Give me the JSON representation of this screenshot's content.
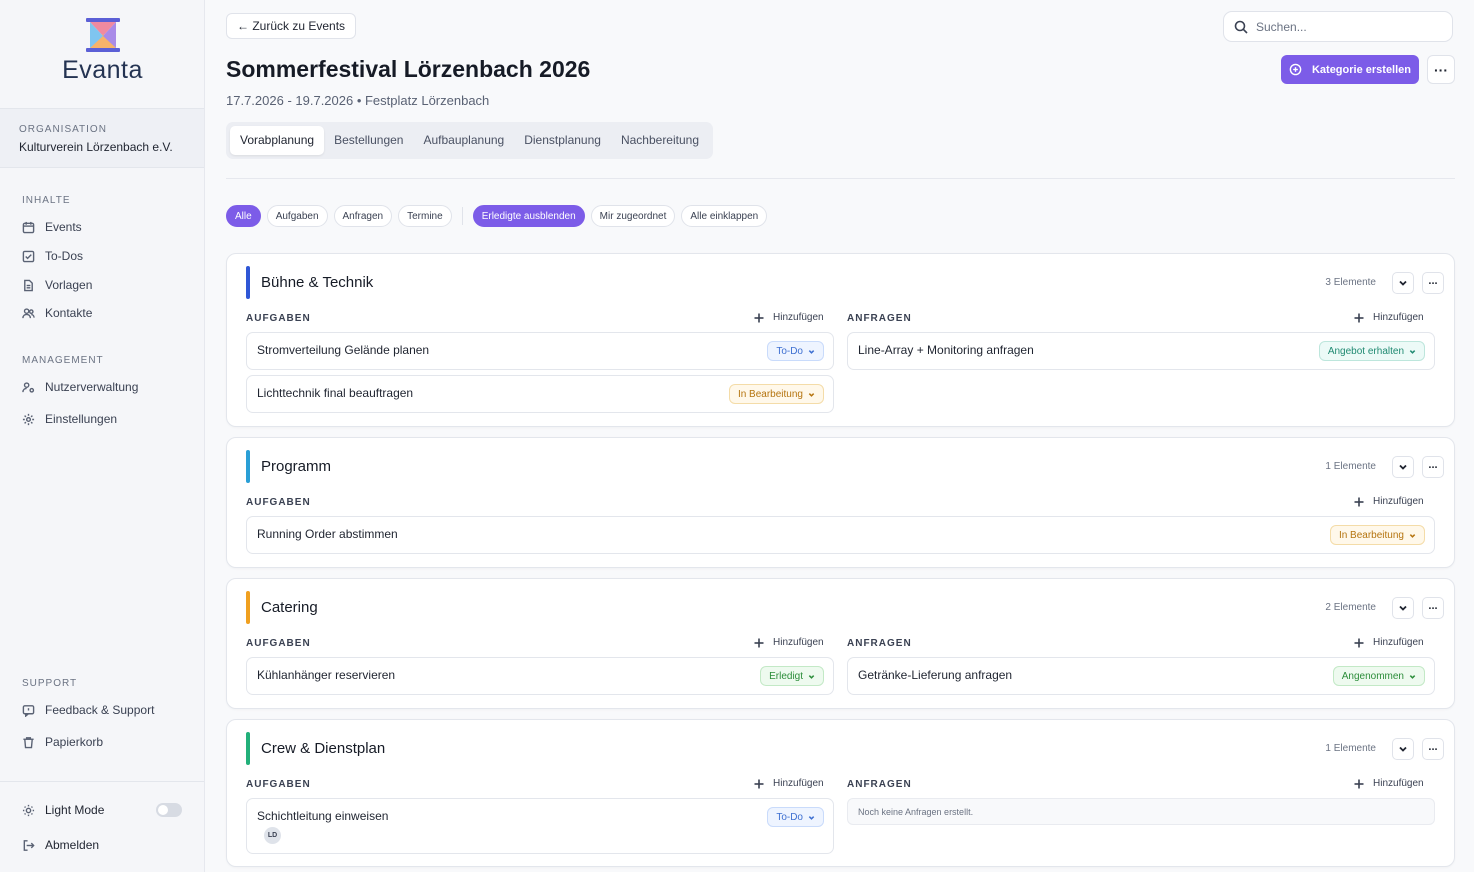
{
  "brand": {
    "name": "Evanta"
  },
  "organisation": {
    "label": "ORGANISATION",
    "name": "Kulturverein Lörzenbach e.V."
  },
  "sidebar": {
    "sections": [
      {
        "label": "INHALTE",
        "items": [
          {
            "label": "Events",
            "icon": "calendar-icon"
          },
          {
            "label": "To-Dos",
            "icon": "checkbox-icon"
          },
          {
            "label": "Vorlagen",
            "icon": "document-icon"
          },
          {
            "label": "Kontakte",
            "icon": "users-icon"
          }
        ]
      },
      {
        "label": "MANAGEMENT",
        "items": [
          {
            "label": "Nutzerverwaltung",
            "icon": "user-settings-icon"
          },
          {
            "label": "Einstellungen",
            "icon": "gear-icon"
          }
        ]
      },
      {
        "label": "SUPPORT",
        "items": [
          {
            "label": "Feedback & Support",
            "icon": "message-icon"
          },
          {
            "label": "Papierkorb",
            "icon": "trash-icon"
          }
        ]
      }
    ],
    "light_mode": {
      "label": "Light Mode",
      "enabled": false
    },
    "logout": "Abmelden"
  },
  "header": {
    "back": "← Zurück zu Events",
    "search_placeholder": "Suchen...",
    "title": "Sommerfestival Lörzenbach 2026",
    "subtitle": "17.7.2026 - 19.7.2026 • Festplatz Lörzenbach",
    "create_button": "Kategorie erstellen",
    "more": "···"
  },
  "tabs": [
    "Vorabplanung",
    "Bestellungen",
    "Aufbauplanung",
    "Dienstplanung",
    "Nachbereitung"
  ],
  "active_tab": "Vorabplanung",
  "filters": [
    "Alle",
    "Aufgaben",
    "Anfragen",
    "Termine"
  ],
  "filters2": [
    "Erledigte ausblenden",
    "Mir zugeordnet",
    "Alle einklappen"
  ],
  "labels": {
    "aufgaben": "AUFGABEN",
    "anfragen": "ANFRAGEN",
    "add": "Hinzufügen"
  },
  "categories": [
    {
      "title": "Bühne & Technik",
      "count": "3 Elemente",
      "color": "#2f57d6",
      "tasks": [
        {
          "title": "Stromverteilung Gelände planen",
          "status": "To-Do"
        },
        {
          "title": "Lichttechnik final beauftragen",
          "status": "In Bearbeitung"
        }
      ],
      "requests": [
        {
          "title": "Line-Array + Monitoring anfragen",
          "status": "Angebot erhalten"
        }
      ]
    },
    {
      "title": "Programm",
      "count": "1 Elemente",
      "color": "#2a9fd6",
      "tasks": [
        {
          "title": "Running Order abstimmen",
          "status": "In Bearbeitung"
        }
      ]
    },
    {
      "title": "Catering",
      "count": "2 Elemente",
      "color": "#f0a020",
      "tasks": [
        {
          "title": "Kühlanhänger reservieren",
          "status": "Erledigt"
        }
      ],
      "requests": [
        {
          "title": "Getränke-Lieferung anfragen",
          "status": "Angenommen"
        }
      ]
    },
    {
      "title": "Crew & Dienstplan",
      "count": "1 Elemente",
      "color": "#22b07a",
      "tasks": [
        {
          "title": "Schichtleitung einweisen",
          "status": "To-Do",
          "assignee": "LD"
        }
      ],
      "requests_empty": "Noch keine Anfragen erstellt."
    }
  ]
}
